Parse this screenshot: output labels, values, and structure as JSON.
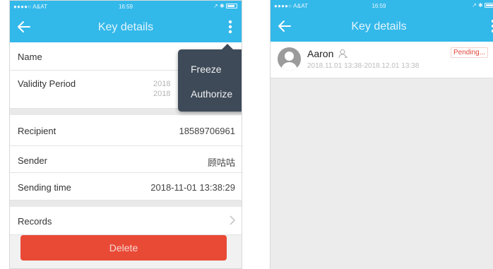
{
  "status_bar": {
    "carrier": "●●●●○ A&AT",
    "time": "16:59",
    "right": "↗ ✱"
  },
  "left_screen": {
    "nav": {
      "title": "Key details"
    },
    "rows": {
      "name_label": "Name",
      "validity_label": "Validity Period",
      "validity_line1": "2018",
      "validity_line2": "2018",
      "recipient_label": "Recipient",
      "recipient_value": "18589706961",
      "sender_label": "Sender",
      "sender_value": "顾咕咕",
      "sending_time_label": "Sending time",
      "sending_time_value": "2018-11-01 13:38:29",
      "records_label": "Records"
    },
    "menu": {
      "freeze": "Freeze",
      "authorize": "Authorize"
    },
    "delete_label": "Delete"
  },
  "right_screen": {
    "nav": {
      "title": "Key details"
    },
    "item": {
      "name": "Aaron",
      "period": "2018.11.01 13:38-2018.12.01 13:38",
      "status": "Pending..."
    }
  },
  "colors": {
    "accent": "#33b8ea",
    "danger": "#e94a36",
    "menu_bg": "#3e4a58",
    "pending": "#e0463a"
  },
  "icons": [
    "back-arrow-icon",
    "more-vertical-icon",
    "chevron-right-icon",
    "user-outline-icon",
    "avatar-icon",
    "battery-icon"
  ]
}
